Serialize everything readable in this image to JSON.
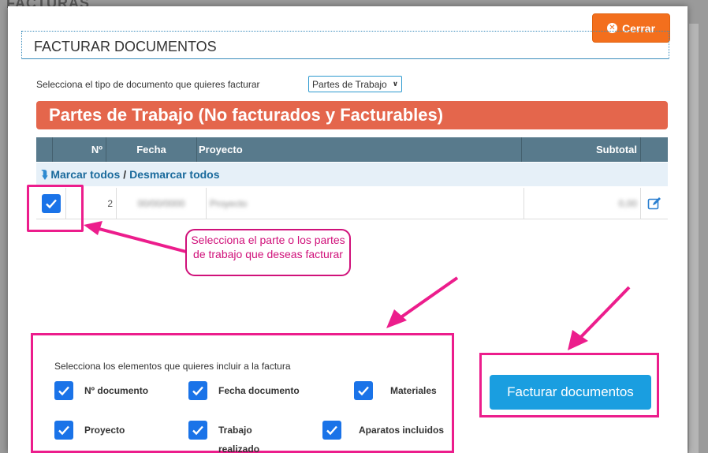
{
  "background": {
    "title": "FACTURAS"
  },
  "modal": {
    "close_label": "Cerrar",
    "title": "FACTURAR DOCUMENTOS",
    "doc_type": {
      "label": "Selecciona el tipo de documento que quieres facturar",
      "selected": "Partes de Trabajo"
    },
    "banner": "Partes de Trabajo (No facturados y Facturables)",
    "table": {
      "headers": {
        "num": "Nº",
        "fecha": "Fecha",
        "proyecto": "Proyecto",
        "subtotal": "Subtotal"
      },
      "select_all": "Marcar todos",
      "separator": "/",
      "deselect_all": "Desmarcar todos",
      "rows": [
        {
          "checked": true,
          "num": "2",
          "fecha": "00/00/0000",
          "proyecto": "Proyecto",
          "subtotal": "0,00"
        }
      ]
    },
    "callout": "Selecciona el parte o los partes de trabajo que deseas facturar",
    "options": {
      "title": "Selecciona los elementos que quieres incluir a la factura",
      "items": [
        {
          "label": "Nº documento",
          "checked": true
        },
        {
          "label": "Fecha documento",
          "checked": true
        },
        {
          "label": "Materiales",
          "checked": true
        },
        {
          "label": "Proyecto",
          "checked": true
        },
        {
          "label": "Trabajo realizado",
          "checked": true
        },
        {
          "label": "Aparatos incluidos",
          "checked": true
        }
      ]
    },
    "bill_button": "Facturar documentos"
  },
  "colors": {
    "close_button": "#f36f1d",
    "banner": "#e4664c",
    "grid_header": "#587a8c",
    "checkbox": "#1a73e8",
    "highlight": "#ec1d8c",
    "bill_button": "#1a9ee0"
  }
}
